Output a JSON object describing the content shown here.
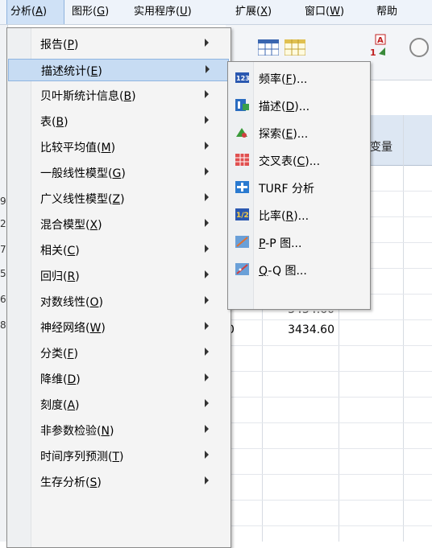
{
  "menubar": {
    "items": [
      {
        "text": "分析",
        "key": "(A)",
        "keyletter": "A"
      },
      {
        "text": "图形",
        "key": "(G)",
        "keyletter": "G"
      },
      {
        "text": "实用程序",
        "key": "(U)",
        "keyletter": "U"
      },
      {
        "text": "扩展",
        "key": "(X)",
        "keyletter": "X"
      },
      {
        "text": "窗口",
        "key": "(W)",
        "keyletter": "W"
      },
      {
        "text": "帮助",
        "key": "",
        "keyletter": ""
      }
    ]
  },
  "analyze_menu": {
    "items": [
      {
        "label": "报告(P)",
        "pre": "报告(",
        "key": "P",
        "post": ")",
        "submenu": true
      },
      {
        "label": "描述统计(E)",
        "pre": "描述统计(",
        "key": "E",
        "post": ")",
        "submenu": true,
        "highlighted": true
      },
      {
        "label": "贝叶斯统计信息(B)",
        "pre": "贝叶斯统计信息(",
        "key": "B",
        "post": ")",
        "submenu": true
      },
      {
        "label": "表(B)",
        "pre": "表(",
        "key": "B",
        "post": ")",
        "submenu": true
      },
      {
        "label": "比较平均值(M)",
        "pre": "比较平均值(",
        "key": "M",
        "post": ")",
        "submenu": true
      },
      {
        "label": "一般线性模型(G)",
        "pre": "一般线性模型(",
        "key": "G",
        "post": ")",
        "submenu": true
      },
      {
        "label": "广义线性模型(Z)",
        "pre": "广义线性模型(",
        "key": "Z",
        "post": ")",
        "submenu": true
      },
      {
        "label": "混合模型(X)",
        "pre": "混合模型(",
        "key": "X",
        "post": ")",
        "submenu": true
      },
      {
        "label": "相关(C)",
        "pre": "相关(",
        "key": "C",
        "post": ")",
        "submenu": true
      },
      {
        "label": "回归(R)",
        "pre": "回归(",
        "key": "R",
        "post": ")",
        "submenu": true
      },
      {
        "label": "对数线性(O)",
        "pre": "对数线性(",
        "key": "O",
        "post": ")",
        "submenu": true
      },
      {
        "label": "神经网络(W)",
        "pre": "神经网络(",
        "key": "W",
        "post": ")",
        "submenu": true
      },
      {
        "label": "分类(F)",
        "pre": "分类(",
        "key": "F",
        "post": ")",
        "submenu": true
      },
      {
        "label": "降维(D)",
        "pre": "降维(",
        "key": "D",
        "post": ")",
        "submenu": true
      },
      {
        "label": "刻度(A)",
        "pre": "刻度(",
        "key": "A",
        "post": ")",
        "submenu": true
      },
      {
        "label": "非参数检验(N)",
        "pre": "非参数检验(",
        "key": "N",
        "post": ")",
        "submenu": true
      },
      {
        "label": "时间序列预测(T)",
        "pre": "时间序列预测(",
        "key": "T",
        "post": ")",
        "submenu": true
      },
      {
        "label": "生存分析(S)",
        "pre": "生存分析(",
        "key": "S",
        "post": ")",
        "submenu": true
      }
    ]
  },
  "descriptive_submenu": {
    "items": [
      {
        "pre": "频率(",
        "key": "F",
        "post": ")...",
        "icon": "frequencies-icon"
      },
      {
        "pre": "描述(",
        "key": "D",
        "post": ")...",
        "icon": "descriptives-icon"
      },
      {
        "pre": "探索(",
        "key": "E",
        "post": ")...",
        "icon": "explore-icon"
      },
      {
        "pre": "交叉表(",
        "key": "C",
        "post": ")...",
        "icon": "crosstabs-icon"
      },
      {
        "pre": "TURF 分析",
        "key": "",
        "post": "",
        "icon": "turf-icon"
      },
      {
        "pre": "比率(",
        "key": "R",
        "post": ")...",
        "icon": "ratio-icon"
      },
      {
        "pre": "",
        "key": "P",
        "post": "-P 图...",
        "icon": "pp-plot-icon"
      },
      {
        "pre": "",
        "key": "Q",
        "post": "-Q 图...",
        "icon": "qq-plot-icon"
      }
    ]
  },
  "data_view": {
    "column_header": "变量",
    "cell_value": "3434.60",
    "left_cell_fragment": "0",
    "row_number_fragments": [
      "9",
      "2",
      "7",
      "5",
      "6",
      "8"
    ]
  },
  "colors": {
    "menubar_bg": "#eef3fa",
    "menu_bg": "#f4f4f4",
    "highlight_bg": "#c7dcf3",
    "highlight_border": "#8eb4e0",
    "header_bg": "#dde7f3"
  }
}
